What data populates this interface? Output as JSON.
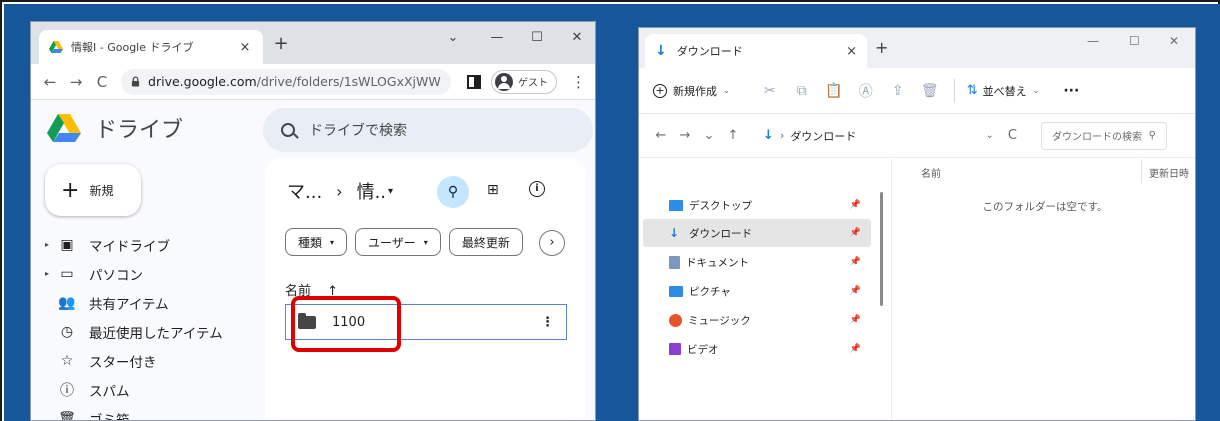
{
  "chrome": {
    "tab_title": "情報Ⅰ - Google ドライブ",
    "tab_close": "×",
    "tab_new": "+",
    "controls": {
      "dropdown": "⌄",
      "minimize": "—",
      "maximize": "☐",
      "close": "✕"
    },
    "nav": {
      "back": "←",
      "forward": "→",
      "reload": "C"
    },
    "url_host": "drive.google.com",
    "url_path": "/drive/folders/1sWLOGxXjWW1...",
    "profile_label": "ゲスト",
    "menu": "⋮"
  },
  "drive": {
    "app_title": "ドライブ",
    "search_placeholder": "ドライブで検索",
    "new_button": {
      "icon": "+",
      "label": "新規"
    },
    "nav_items": [
      {
        "label": "マイドライブ",
        "icon": "hdd-icon",
        "glyph": "▣",
        "caret": "▸"
      },
      {
        "label": "パソコン",
        "icon": "computer-icon",
        "glyph": "▭",
        "caret": "▸"
      },
      {
        "label": "共有アイテム",
        "icon": "people-icon",
        "glyph": "👥",
        "caret": ""
      },
      {
        "label": "最近使用したアイテム",
        "icon": "clock-icon",
        "glyph": "◷",
        "caret": ""
      },
      {
        "label": "スター付き",
        "icon": "star-icon",
        "glyph": "☆",
        "caret": ""
      },
      {
        "label": "スパム",
        "icon": "spam-icon",
        "glyph": "ⓘ",
        "caret": ""
      },
      {
        "label": "ゴミ箱",
        "icon": "trash-icon",
        "glyph": "🗑",
        "caret": ""
      }
    ],
    "breadcrumb": {
      "parent": "マ...",
      "sep": "›",
      "current": "情..",
      "caret": "▾"
    },
    "toolbar": {
      "filter": "⚲",
      "grid": "⊞",
      "info": "i"
    },
    "chips": [
      {
        "label": "種類",
        "caret": "▾"
      },
      {
        "label": "ユーザー",
        "caret": "▾"
      },
      {
        "label": "最終更新",
        "caret": ""
      }
    ],
    "chip_next": "›",
    "column_name": "名前",
    "sort_arrow": "↑",
    "files": [
      {
        "name": "1100",
        "menu": "⋮"
      }
    ]
  },
  "explorer": {
    "tab_title": "ダウンロード",
    "tab_close": "×",
    "tab_new": "+",
    "controls": {
      "minimize": "—",
      "maximize": "☐",
      "close": "✕"
    },
    "cmd": {
      "new_label": "新規作成",
      "new_icon": "+",
      "new_caret": "⌄",
      "cut": "✂",
      "copy": "⧉",
      "paste": "📋",
      "rename": "Ⓐ",
      "share": "⇪",
      "delete": "🗑",
      "sort_label": "並べ替え",
      "sort_icon": "⇅",
      "sort_caret": "⌄",
      "more": "···"
    },
    "nav": {
      "back": "←",
      "forward": "→",
      "recent": "⌄",
      "up": "↑"
    },
    "address": {
      "icon": "↓",
      "sep": "›",
      "path": "ダウンロード",
      "chevron": "⌄",
      "refresh": "C"
    },
    "search_placeholder": "ダウンロードの検索",
    "search_icon": "⚲",
    "quick_access": [
      {
        "label": "デスクトップ",
        "color": "#2e8ce6",
        "selected": false
      },
      {
        "label": "ダウンロード",
        "color": "#1b7be0",
        "selected": true
      },
      {
        "label": "ドキュメント",
        "color": "#7a98c2",
        "selected": false
      },
      {
        "label": "ピクチャ",
        "color": "#2e8ce6",
        "selected": false
      },
      {
        "label": "ミュージック",
        "color": "#e8542a",
        "selected": false
      },
      {
        "label": "ビデオ",
        "color": "#8b3fd1",
        "selected": false
      }
    ],
    "pin_icon": "📌",
    "columns": {
      "name": "名前",
      "modified": "更新日時"
    },
    "empty_message": "このフォルダーは空です。"
  },
  "colors": {
    "desktop": "#16579b",
    "highlight_box": "#e00000",
    "drive_filter_active": "#c2e7ff",
    "explorer_accent": "#1b7be0"
  }
}
